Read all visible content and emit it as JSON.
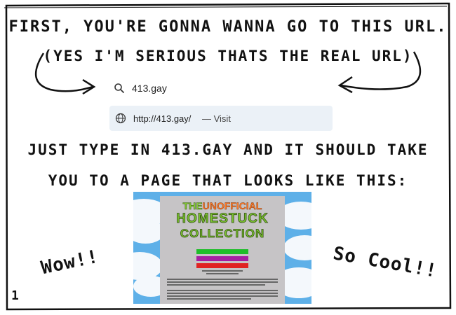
{
  "comic": {
    "line1": "First, you're gonna wanna go to this URL.",
    "line2": "(Yes I'm serious thats the real url)",
    "line3": "Just type in 413.gay and it should take",
    "line4": "you to a page that looks like this:",
    "exclaim_left": "Wow!!",
    "exclaim_right": "So Cool!!",
    "panel_number": "1"
  },
  "browser": {
    "search_icon": "search-icon",
    "search_text": "413.gay",
    "suggestion_icon": "globe-icon",
    "suggestion_url": "http://413.gay/",
    "suggestion_action": "— Visit"
  },
  "website_preview": {
    "title_the": "THE",
    "title_unofficial": "UNOFFICIAL",
    "title_homestuck": "HOMESTUCK",
    "title_collection": "COLLECTION"
  }
}
